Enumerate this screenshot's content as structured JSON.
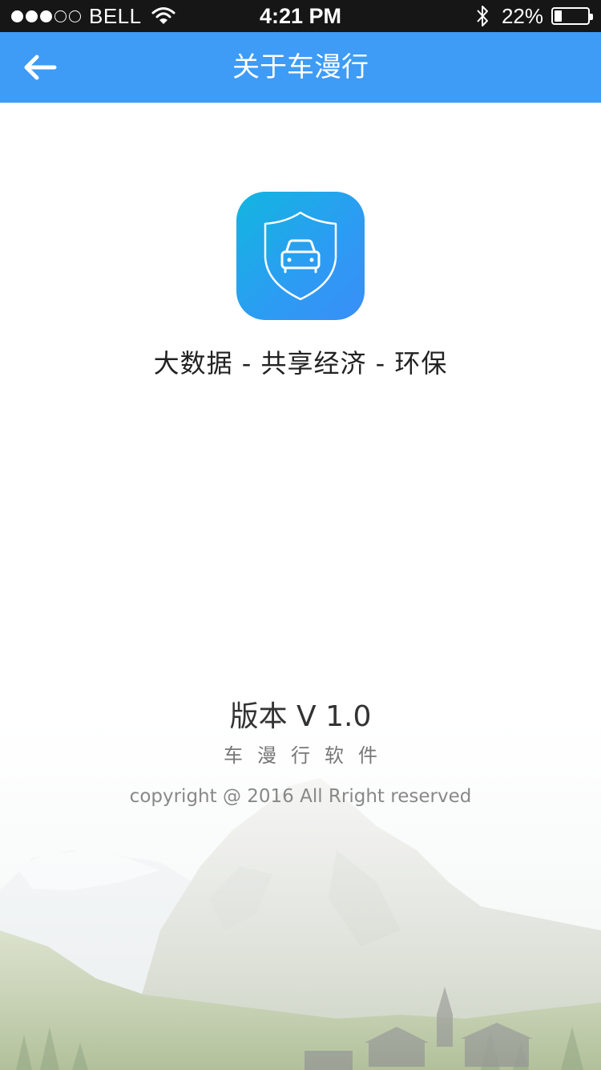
{
  "status_bar": {
    "carrier": "BELL",
    "time": "4:21 PM",
    "battery_percent": "22%",
    "battery_level": 0.22,
    "signal_bars_on": 3,
    "signal_bars_total": 5
  },
  "nav": {
    "back_icon": "arrow-left-icon",
    "title": "关于车漫行"
  },
  "app": {
    "icon": "shield-car-icon",
    "slogan": "大数据 - 共享经济 - 环保"
  },
  "footer": {
    "version": "版本 V 1.0",
    "software": "车漫行软件",
    "copyright": "copyright @ 2016 All Rright reserved"
  },
  "colors": {
    "nav_bg": "#3e9bf6",
    "status_bg": "#161616",
    "icon_gradient_start": "#12b6e0",
    "icon_gradient_end": "#3a8ef8"
  }
}
